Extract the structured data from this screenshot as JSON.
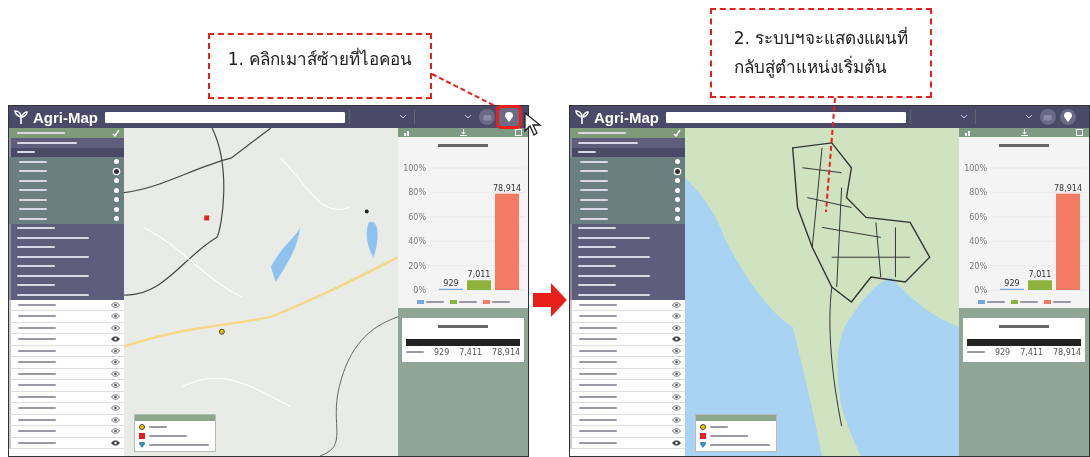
{
  "annotations": [
    {
      "text": "1. คลิกเมาส์ซ้ายที่ไอคอน"
    },
    {
      "text": "2. ระบบฯจะแสดงแผนที่\nกลับสู่ตำแหน่งเริ่มต้น"
    }
  ],
  "screenshots": [
    {
      "map": {
        "kind": "province"
      },
      "home_button_highlighted": true,
      "cursor": true,
      "logo": "Agri-Map",
      "menu_items": [
        {
          "selected": false
        },
        {
          "selected": true
        },
        {
          "selected": false
        },
        {
          "selected": false
        },
        {
          "selected": false
        },
        {
          "selected": false
        },
        {
          "selected": false
        },
        {
          "selected": false
        },
        {
          "selected": false
        },
        {
          "selected": false
        }
      ],
      "radio_items": [
        {
          "selected": false
        },
        {
          "selected": true
        },
        {
          "selected": false
        },
        {
          "selected": false
        },
        {
          "selected": false
        },
        {
          "selected": false
        },
        {
          "selected": false
        }
      ],
      "layers": [
        {
          "visible": false
        },
        {
          "visible": false
        },
        {
          "visible": false
        },
        {
          "visible": true
        },
        {
          "visible": false
        },
        {
          "visible": false
        },
        {
          "visible": false
        },
        {
          "visible": false
        },
        {
          "visible": false
        },
        {
          "visible": false
        },
        {
          "visible": false
        },
        {
          "visible": false
        },
        {
          "visible": true
        }
      ],
      "chart_data": {
        "type": "bar",
        "categories": [
          null
        ],
        "yticks": [
          {
            "value": 0,
            "label": "0%"
          },
          {
            "value": 20,
            "label": "20%"
          },
          {
            "value": 40,
            "label": "40%"
          },
          {
            "value": 60,
            "label": "60%"
          },
          {
            "value": 80,
            "label": "80%"
          },
          {
            "value": 100,
            "label": "100%"
          }
        ],
        "ylim": [
          0,
          100
        ],
        "series": [
          {
            "color": "#6fa8dc",
            "values": [
              1
            ]
          },
          {
            "color": "#8db43a",
            "values": [
              8
            ]
          },
          {
            "color": "#f47b63",
            "values": [
              79
            ]
          }
        ],
        "grid": true,
        "value_labels": [
          "929",
          "7,011",
          "78,914"
        ]
      },
      "table_row": [
        "929",
        "7,411",
        "78,914"
      ]
    },
    {
      "map": {
        "kind": "country"
      },
      "home_button_highlighted": false,
      "logo": "Agri-Map",
      "menu_items": [
        {
          "selected": false
        },
        {
          "selected": true
        },
        {
          "selected": false
        },
        {
          "selected": false
        },
        {
          "selected": false
        },
        {
          "selected": false
        },
        {
          "selected": false
        },
        {
          "selected": false
        },
        {
          "selected": false
        },
        {
          "selected": false
        }
      ],
      "radio_items": [
        {
          "selected": false
        },
        {
          "selected": true
        },
        {
          "selected": false
        },
        {
          "selected": false
        },
        {
          "selected": false
        },
        {
          "selected": false
        },
        {
          "selected": false
        }
      ],
      "layers": [
        {
          "visible": false
        },
        {
          "visible": false
        },
        {
          "visible": false
        },
        {
          "visible": true
        },
        {
          "visible": false
        },
        {
          "visible": false
        },
        {
          "visible": false
        },
        {
          "visible": false
        },
        {
          "visible": false
        },
        {
          "visible": false
        },
        {
          "visible": false
        },
        {
          "visible": false
        },
        {
          "visible": true
        }
      ],
      "chart_data": {
        "type": "bar",
        "categories": [
          null
        ],
        "yticks": [
          {
            "value": 0,
            "label": "0%"
          },
          {
            "value": 20,
            "label": "20%"
          },
          {
            "value": 40,
            "label": "40%"
          },
          {
            "value": 60,
            "label": "60%"
          },
          {
            "value": 80,
            "label": "80%"
          },
          {
            "value": 100,
            "label": "100%"
          }
        ],
        "ylim": [
          0,
          100
        ],
        "series": [
          {
            "color": "#6fa8dc",
            "values": [
              1
            ]
          },
          {
            "color": "#8db43a",
            "values": [
              8
            ]
          },
          {
            "color": "#f47b63",
            "values": [
              79
            ]
          }
        ],
        "grid": true,
        "value_labels": [
          "929",
          "7,011",
          "78,914"
        ]
      },
      "table_row": [
        "929",
        "7,411",
        "78,914"
      ]
    }
  ]
}
